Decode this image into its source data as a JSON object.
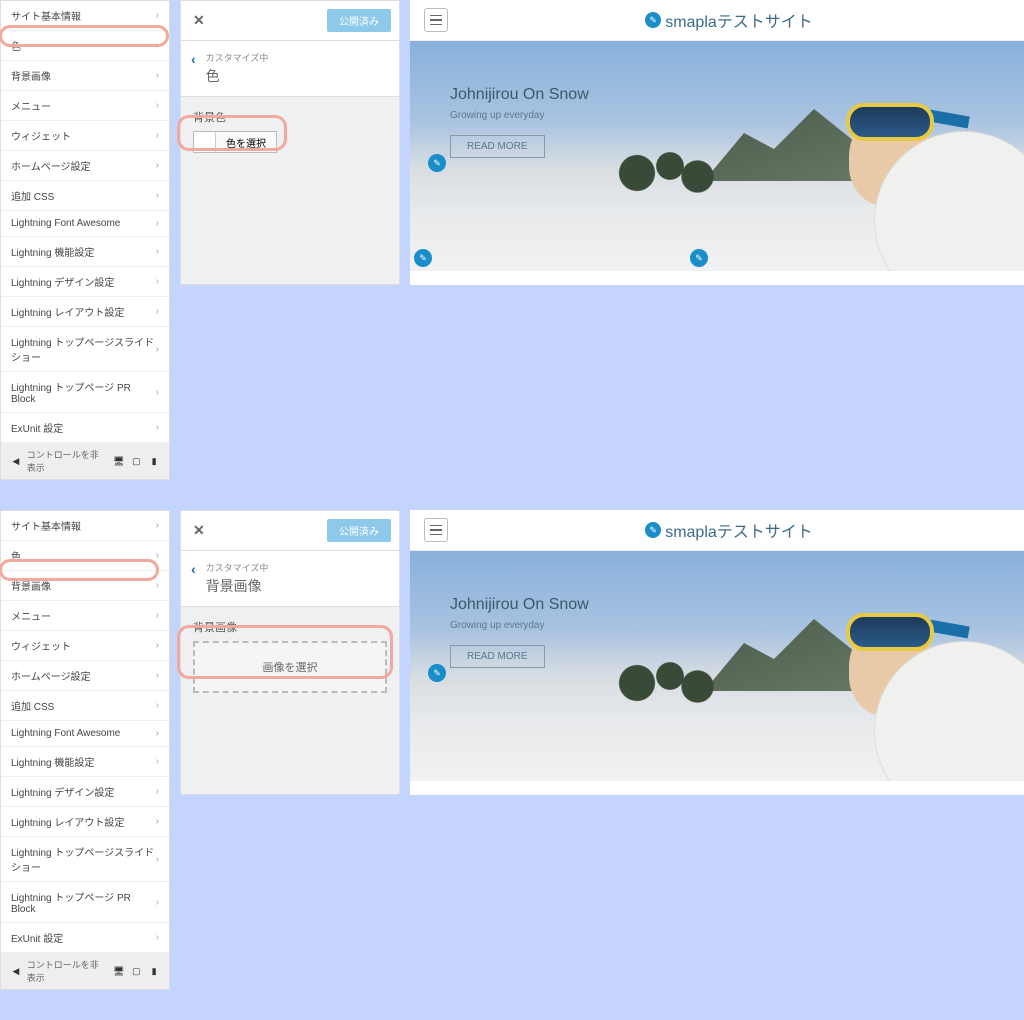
{
  "sidebar": {
    "items": [
      {
        "label": "サイト基本情報"
      },
      {
        "label": "色"
      },
      {
        "label": "背景画像"
      },
      {
        "label": "メニュー"
      },
      {
        "label": "ウィジェット"
      },
      {
        "label": "ホームページ設定"
      },
      {
        "label": "追加 CSS"
      },
      {
        "label": "Lightning Font Awesome"
      },
      {
        "label": "Lightning 機能設定"
      },
      {
        "label": "Lightning デザイン設定"
      },
      {
        "label": "Lightning レイアウト設定"
      },
      {
        "label": "Lightning トップページスライドショー"
      },
      {
        "label": "Lightning トップページ PR Block"
      },
      {
        "label": "ExUnit 設定"
      }
    ],
    "footer_hide": "コントロールを非表示"
  },
  "customizer": {
    "publish_label": "公開済み",
    "customizing": "カスタマイズ中",
    "color_title": "色",
    "bg_image_title": "背景画像",
    "bg_color_label": "背景色",
    "bg_image_label": "背景画像",
    "select_color": "色を選択",
    "select_image": "画像を選択"
  },
  "preview": {
    "site_name": "smaplaテストサイト",
    "hero_title": "Johnijirou On Snow",
    "hero_sub": "Growing up everyday",
    "read_more": "READ MORE"
  }
}
